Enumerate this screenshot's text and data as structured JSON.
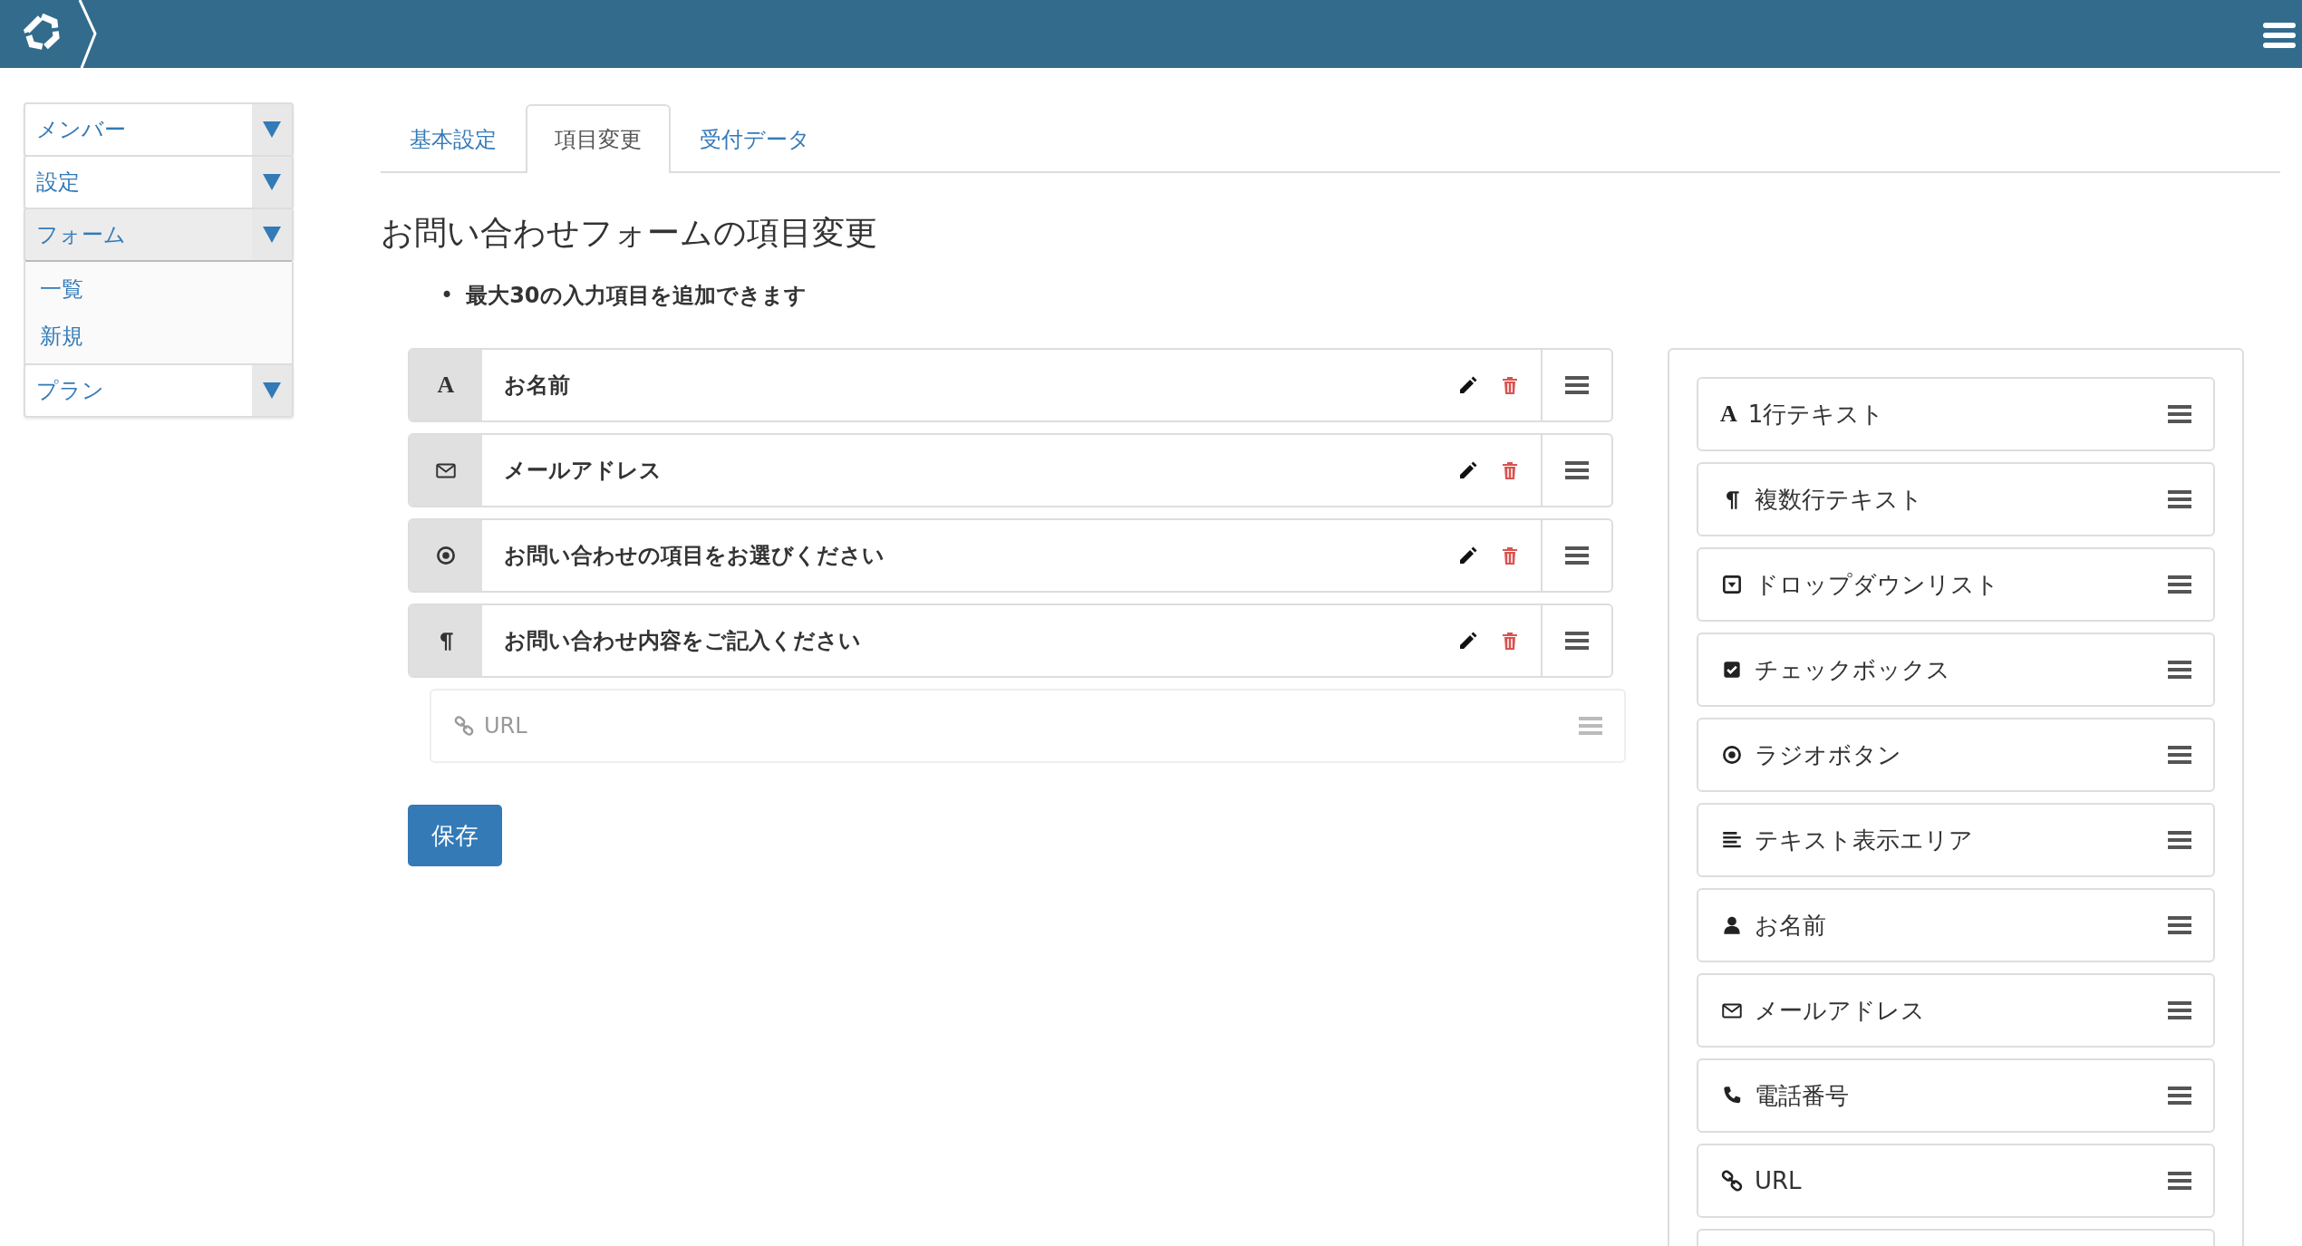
{
  "sidebar": {
    "items": [
      {
        "label": "メンバー",
        "expanded": false
      },
      {
        "label": "設定",
        "expanded": false
      },
      {
        "label": "フォーム",
        "expanded": true,
        "children": [
          {
            "label": "一覧"
          },
          {
            "label": "新規"
          }
        ]
      },
      {
        "label": "プラン",
        "expanded": false
      }
    ]
  },
  "tabs": [
    {
      "label": "基本設定",
      "selected": false
    },
    {
      "label": "項目変更",
      "selected": true
    },
    {
      "label": "受付データ",
      "selected": false
    }
  ],
  "heading": "お問い合わせフォームの項目変更",
  "notes": [
    {
      "bullet": "•",
      "text": "最大30の入力項目を追加できます"
    }
  ],
  "fields": [
    {
      "kind": "text",
      "glyph": "A",
      "label": "お名前"
    },
    {
      "kind": "email",
      "label": "メールアドレス"
    },
    {
      "kind": "radio",
      "label": "お問い合わせの項目をお選びください"
    },
    {
      "kind": "textarea",
      "label": "お問い合わせ内容をご記入ください"
    }
  ],
  "dragging": {
    "kind": "url",
    "label": "URL"
  },
  "save_button": "保存",
  "palette": [
    {
      "kind": "text",
      "glyph": "A",
      "label": "1行テキスト"
    },
    {
      "kind": "textarea",
      "label": "複数行テキスト"
    },
    {
      "kind": "dropdown",
      "label": "ドロップダウンリスト"
    },
    {
      "kind": "checkbox",
      "label": "チェックボックス"
    },
    {
      "kind": "radio",
      "label": "ラジオボタン"
    },
    {
      "kind": "display",
      "label": "テキスト表示エリア"
    },
    {
      "kind": "name",
      "label": "お名前"
    },
    {
      "kind": "email",
      "label": "メールアドレス"
    },
    {
      "kind": "tel",
      "label": "電話番号"
    },
    {
      "kind": "url",
      "label": "URL"
    }
  ]
}
